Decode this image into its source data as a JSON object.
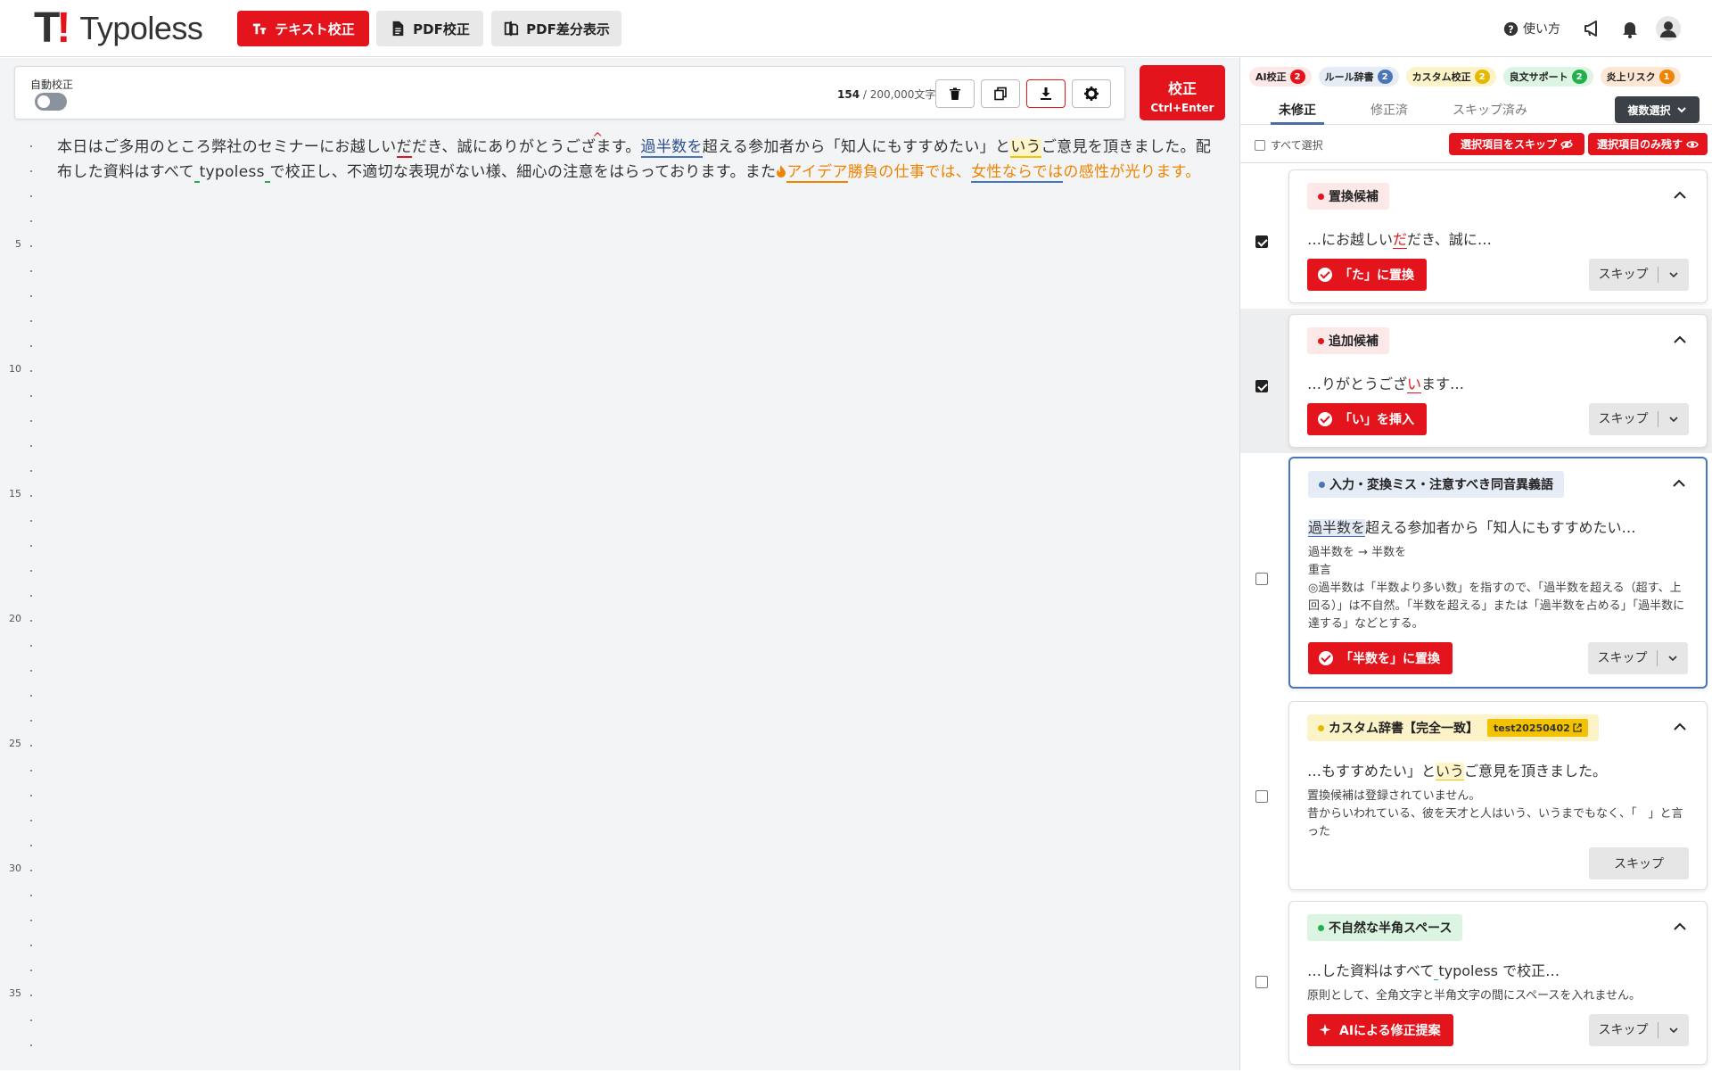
{
  "header": {
    "brand": "Typoless",
    "logo_mark": "T!",
    "buttons": {
      "text": "テキスト校正",
      "pdf": "PDF校正",
      "diff": "PDF差分表示"
    },
    "help": "使い方",
    "icons": [
      "megaphone-icon",
      "bell-icon",
      "user-icon"
    ]
  },
  "toolbar": {
    "auto_label": "自動校正",
    "auto_on": false,
    "count": "154",
    "count_max": "/ 200,000文字",
    "run_label": "校正",
    "run_shortcut": "Ctrl+Enter"
  },
  "gutter": {
    "numbers": [
      "5",
      "10",
      "15",
      "20",
      "25",
      "30",
      "35"
    ]
  },
  "document": {
    "s1": "本日はご多用のところ弊社のセミナーにお越しい",
    "e1": "だ",
    "s2": "だき、誠にありがとうござ",
    "s3": "ます。",
    "e3": "過半数を",
    "s4": "超える参加者から「知人にもすすめたい」と",
    "e4": "いう",
    "s5": "ご意見を頂きました。配布した資料はすべて",
    "e5": " ",
    "s6": "typoless",
    "e6": " ",
    "s7": "で校正し、不適切な表現がない様、細心の注意をはらっております。また",
    "e7": "アイデア",
    "s8": "勝負の仕事では、",
    "e8": "女性ならでは",
    "s9": "の感性が光ります。"
  },
  "panel": {
    "chips": [
      {
        "label": "AI校正",
        "count": "2",
        "bg": "#fde8e8",
        "badge": "#e3141c"
      },
      {
        "label": "ルール辞書",
        "count": "2",
        "bg": "#e5ecf6",
        "badge": "#4a76b7"
      },
      {
        "label": "カスタム校正",
        "count": "2",
        "bg": "#fdf3c8",
        "badge": "#e6b800"
      },
      {
        "label": "良文サポート",
        "count": "2",
        "bg": "#dcf4e2",
        "badge": "#22b04a"
      },
      {
        "label": "炎上リスク",
        "count": "1",
        "bg": "#fde6d3",
        "badge": "#f08300"
      }
    ],
    "tabs": {
      "unfixed": "未修正",
      "fixed": "修正済",
      "skipped": "スキップ済み"
    },
    "multi": "複数選択",
    "select_all": "すべて選択",
    "skip_selected": "選択項目をスキップ",
    "keep_selected": "選択項目のみ残す",
    "cards": [
      {
        "tag": "置換候補",
        "dot": "#e3141c",
        "tag_bg": "#fde8e8",
        "pre": "…にお越しい",
        "hl": "だ",
        "post": "だき、誠に…",
        "fix": "「た」に置換",
        "skip": "スキップ",
        "checked": true
      },
      {
        "tag": "追加候補",
        "dot": "#e3141c",
        "tag_bg": "#fde8e8",
        "pre": "…りがとうござ",
        "hl": "い",
        "post": "ます…",
        "fix": "「い」を挿入",
        "skip": "スキップ",
        "checked": true
      },
      {
        "tag": "入力・変換ミス・注意すべき同音異義語",
        "dot": "#4a76b7",
        "tag_bg": "#e5ecf6",
        "pre": "",
        "hl": "過半数を",
        "post": "超える参加者から「知人にもすすめたい…",
        "desc1": "過半数を → 半数を",
        "desc2": "重言",
        "desc3": "◎過半数は「半数より多い数」を指すので、「過半数を超える（超す、上回る）」は不自然。「半数を超える」または「過半数を占める」「過半数に達する」などとする。",
        "fix": "「半数を」に置換",
        "skip": "スキップ",
        "checked": false
      },
      {
        "tag": "カスタム辞書【完全一致】",
        "dict": "test20250402",
        "dot": "#e6b800",
        "tag_bg": "#fdf3c8",
        "pre": "…もすすめたい」と",
        "hl": "いう",
        "post": "ご意見を頂きました。",
        "desc1": "置換候補は登録されていません。",
        "desc2": "昔からいわれている、彼を天才と人はいう、いうまでもなく、「　」と言った",
        "skip": "スキップ",
        "checked": false
      },
      {
        "tag": "不自然な半角スペース",
        "dot": "#22b04a",
        "tag_bg": "#dcf4e2",
        "pre": "…した資料はすべて",
        "hl": " ",
        "post": "typoless で校正…",
        "desc1": "原則として、全角文字と半角文字の間にスペースを入れません。",
        "fix": "AIによる修正提案",
        "skip": "スキップ",
        "checked": false
      }
    ]
  }
}
